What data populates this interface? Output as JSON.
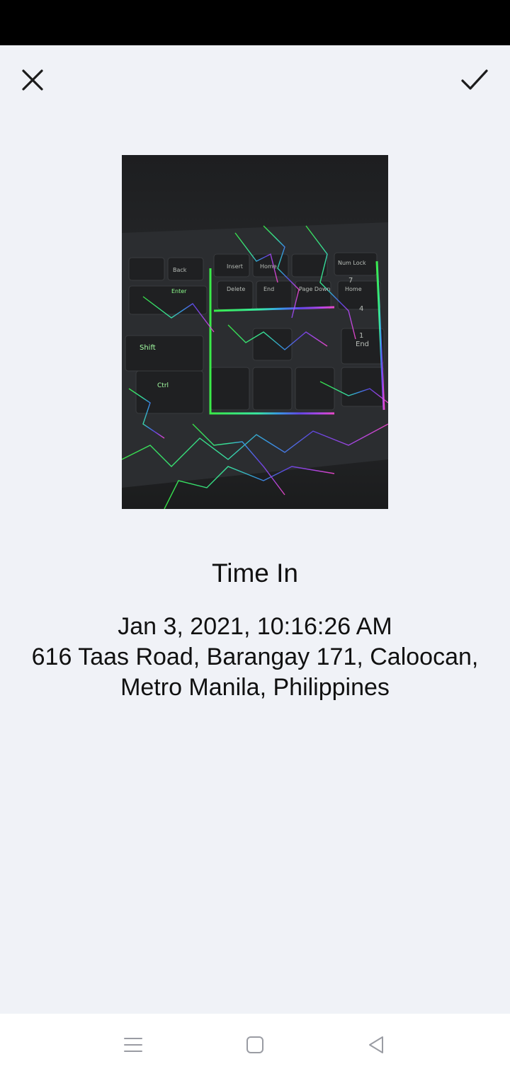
{
  "header": {
    "close_icon": "close-icon",
    "confirm_icon": "checkmark-icon"
  },
  "photo": {
    "subject": "backlit keyboard with rainbow lightning-crack lighting",
    "key_labels": [
      "Back",
      "Insert",
      "Home",
      "Num Lock",
      "Enter",
      "Delete",
      "End",
      "Page Down",
      "Home",
      "Shift",
      "Ctrl",
      "End",
      "7",
      "1",
      "4"
    ]
  },
  "record": {
    "title": "Time In",
    "datetime": "Jan 3, 2021, 10:16:26 AM",
    "address_line1": "616 Taas Road, Barangay 171, Caloocan,",
    "address_line2": "Metro Manila, Philippines"
  },
  "nav": {
    "menu_icon": "menu-icon",
    "home_icon": "home-square-icon",
    "back_icon": "back-triangle-icon"
  },
  "colors": {
    "background": "#f0f2f7",
    "status_bar": "#000000",
    "nav_bar": "#ffffff",
    "nav_icon": "#9a9ca3"
  }
}
